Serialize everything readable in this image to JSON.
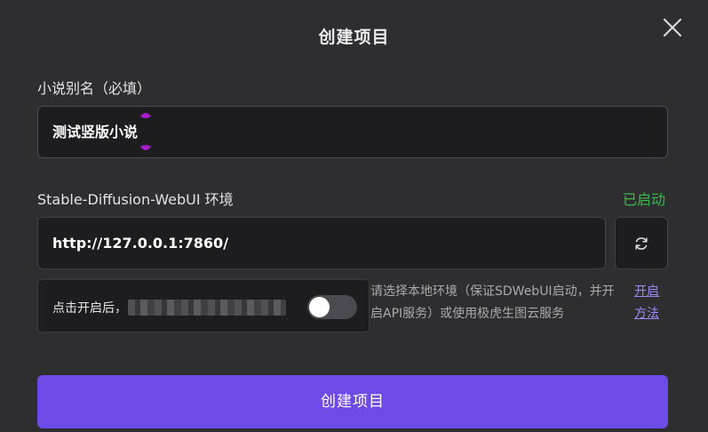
{
  "dialog": {
    "title": "创建项目",
    "close_icon": "close-icon"
  },
  "name_field": {
    "label": "小说别名（必填）",
    "value": "测试竖版小说"
  },
  "env_field": {
    "label": "Stable-Diffusion-WebUI 环境",
    "status": "已启动",
    "status_color": "#3fb94c",
    "value": "http://127.0.0.1:7860/",
    "refresh_icon": "refresh-icon"
  },
  "toggle": {
    "label": "点击开启后，",
    "on": false
  },
  "hint": {
    "text": "请选择本地环境（保证SDWebUI启动，并开启API服务）或使用极虎生图云服务",
    "link": "开启方法"
  },
  "submit": {
    "label": "创建项目",
    "color": "#6e4be6"
  }
}
